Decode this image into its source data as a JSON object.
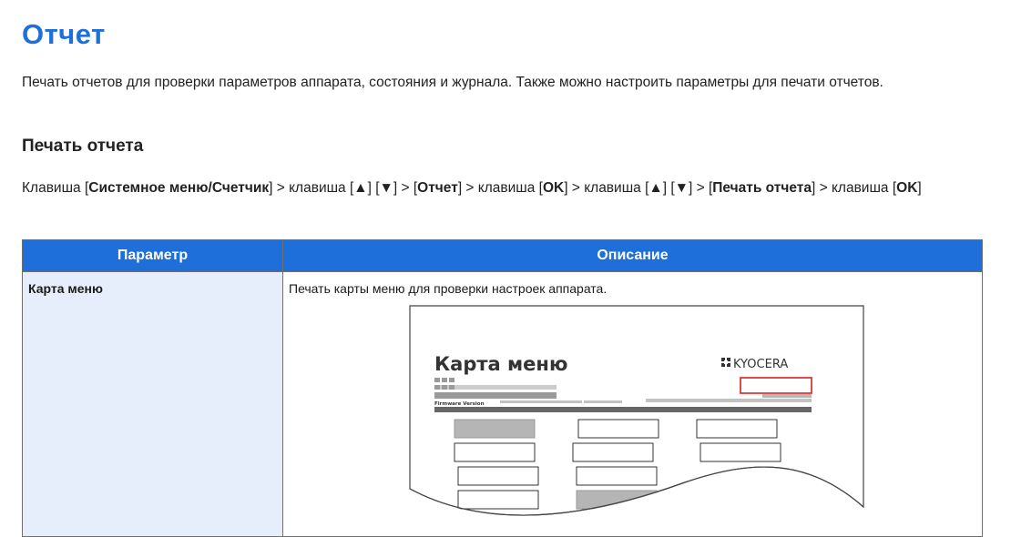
{
  "page": {
    "title": "Отчет",
    "intro": "Печать отчетов для проверки параметров аппарата, состояния и журнала. Также можно настроить параметры для печати отчетов."
  },
  "section": {
    "title": "Печать отчета",
    "path": {
      "t1": "Клавиша [",
      "b1": "Системное меню/Счетчик",
      "t2": "] > клавиша [▲] [▼] > [",
      "b2": "Отчет",
      "t3": "] > клавиша [",
      "b3": "OK",
      "t4": "] > клавиша [▲] [▼] > [",
      "b4": "Печать отчета",
      "t5": "] > клавиша [",
      "b5": "OK",
      "t6": "]"
    }
  },
  "table": {
    "headers": [
      "Параметр",
      "Описание"
    ],
    "rows": [
      {
        "param": "Карта меню",
        "description": "Печать карты меню для проверки настроек аппарата."
      }
    ]
  },
  "illustration": {
    "title": "Карта меню",
    "logo": "KYOCERA",
    "firmware_label": "Firmware Version"
  },
  "colors": {
    "accent": "#1e6fd9",
    "param_cell_bg": "#e6eefb",
    "highlight": "#d62020"
  }
}
